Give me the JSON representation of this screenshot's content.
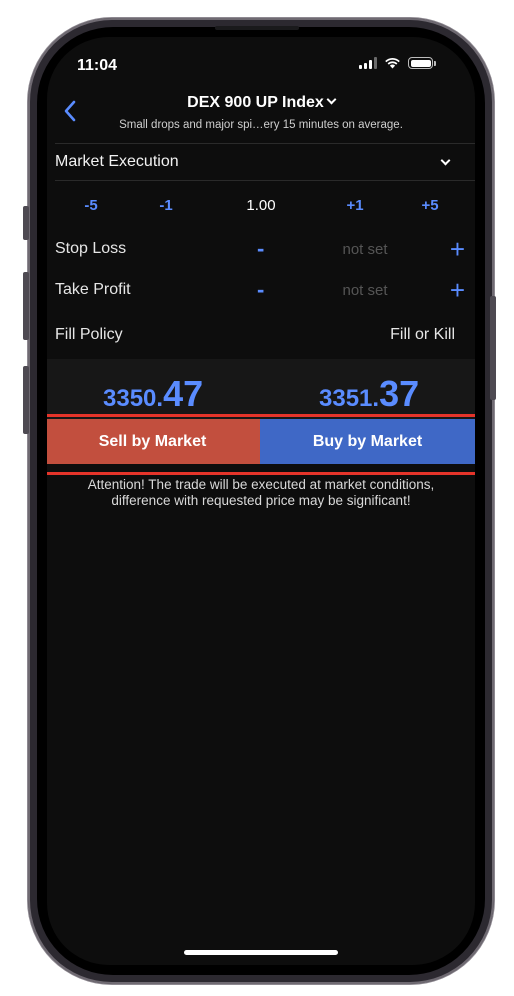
{
  "status_bar": {
    "time": "11:04",
    "battery_level": 1.0
  },
  "header": {
    "title": "DEX 900 UP Index",
    "subtitle": "Small drops and major spi…ery 15 minutes on average."
  },
  "order_type": {
    "label": "Market Execution"
  },
  "volume": {
    "steps_left": [
      "-5",
      "-1"
    ],
    "value": "1.00",
    "steps_right": [
      "+1",
      "+5"
    ]
  },
  "stop_loss": {
    "label": "Stop Loss",
    "minus": "-",
    "value": "not set",
    "plus": "+"
  },
  "take_profit": {
    "label": "Take Profit",
    "minus": "-",
    "value": "not set",
    "plus": "+"
  },
  "fill_policy": {
    "label": "Fill Policy",
    "value": "Fill or Kill"
  },
  "prices": {
    "bid_main": "3350.",
    "bid_pips": "47",
    "ask_main": "3351.",
    "ask_pips": "37"
  },
  "buttons": {
    "sell": "Sell by Market",
    "buy": "Buy by Market"
  },
  "attention_text": "Attention! The trade will be executed at market conditions, difference with requested price may be significant!",
  "colors": {
    "accent_blue": "#5a8cff",
    "sell_red": "#c24f3e",
    "buy_blue": "#3f68c6",
    "highlight_red": "#e5342a"
  }
}
